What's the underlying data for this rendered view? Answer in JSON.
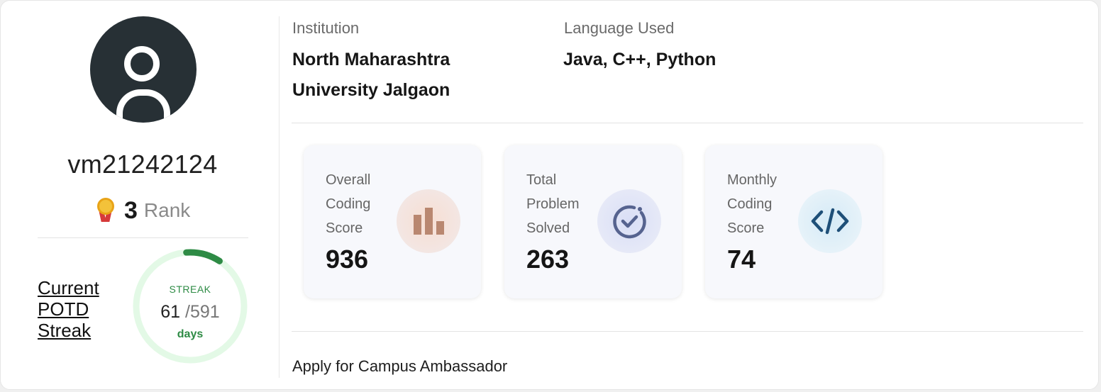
{
  "profile": {
    "username": "vm21242124",
    "rank_number": "3",
    "rank_label": "Rank"
  },
  "potd": {
    "label_line1": "Current",
    "label_line2": "POTD",
    "label_line3": "Streak",
    "streak_title": "STREAK",
    "current": "61",
    "total": "/591",
    "unit": "days",
    "progress_fraction": 0.103
  },
  "info": {
    "institution_label": "Institution",
    "institution_line1": "North Maharashtra",
    "institution_line2": "University Jalgaon",
    "language_label": "Language Used",
    "language_value": "Java, C++, Python"
  },
  "stats": [
    {
      "label_line1": "Overall",
      "label_line2": "Coding",
      "label_line3": "Score",
      "value": "936",
      "icon": "bar-chart-icon"
    },
    {
      "label_line1": "Total",
      "label_line2": "Problem",
      "label_line3": "Solved",
      "value": "263",
      "icon": "check-circle-icon"
    },
    {
      "label_line1": "Monthly",
      "label_line2": "Coding",
      "label_line3": "Score",
      "value": "74",
      "icon": "code-icon"
    }
  ],
  "links": {
    "campus_ambassador": "Apply for Campus Ambassador"
  },
  "colors": {
    "streak_green": "#2e8b45",
    "ring_track": "#e3f9e6",
    "avatar_bg": "#273035"
  }
}
